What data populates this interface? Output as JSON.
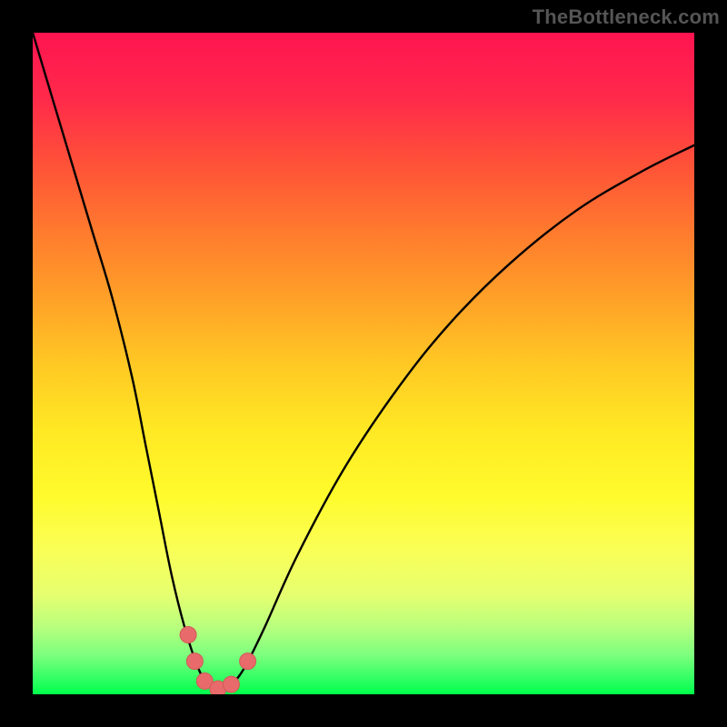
{
  "watermark": "TheBottleneck.com",
  "chart_data": {
    "type": "line",
    "title": "",
    "xlabel": "",
    "ylabel": "",
    "xlim": [
      0,
      100
    ],
    "ylim": [
      0,
      100
    ],
    "grid": false,
    "legend": false,
    "annotations": [],
    "series": [
      {
        "name": "bottleneck-curve",
        "x": [
          0,
          3,
          6,
          9,
          12,
          15,
          17,
          19,
          21,
          23,
          25,
          26.5,
          28,
          30,
          32,
          35,
          40,
          47,
          55,
          63,
          72,
          82,
          92,
          100
        ],
        "y": [
          100,
          90,
          80,
          70,
          60,
          48,
          38,
          28,
          18,
          10,
          4,
          1.5,
          0.5,
          1.5,
          4,
          10,
          21,
          34,
          46,
          56,
          65,
          73,
          79,
          83
        ]
      }
    ],
    "markers": [
      {
        "name": "dot-left-upper",
        "x": 23.5,
        "y": 9
      },
      {
        "name": "dot-left-lower",
        "x": 24.5,
        "y": 5
      },
      {
        "name": "dot-bottom-1",
        "x": 26,
        "y": 2
      },
      {
        "name": "dot-bottom-2",
        "x": 28,
        "y": 0.8
      },
      {
        "name": "dot-bottom-3",
        "x": 30,
        "y": 1.5
      },
      {
        "name": "dot-right",
        "x": 32.5,
        "y": 5
      }
    ],
    "colors": {
      "curve": "#000000",
      "marker_fill": "#e86a6a",
      "marker_stroke": "#d25a5a",
      "background_top": "#ff1450",
      "background_bottom": "#00ff4a"
    }
  }
}
